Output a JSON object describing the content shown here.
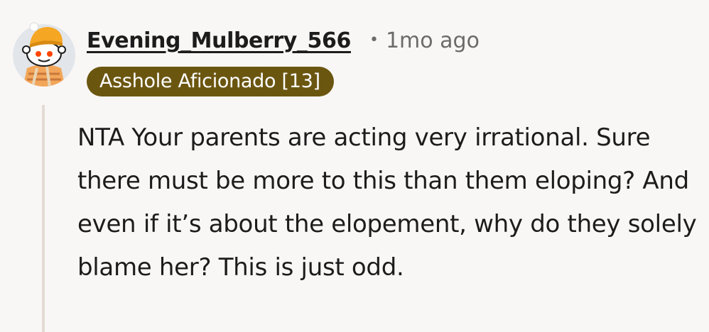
{
  "comment": {
    "author": "Evening_Mulberry_566",
    "separator": "•",
    "timestamp": "1mo ago",
    "flair": "Asshole Aficionado [13]",
    "body": "NTA Your parents are acting very irrational. Sure there must be more to this than them eloping? And even if it’s about the elopement, why do they solely blame her? This is just odd."
  },
  "colors": {
    "background": "#f9f7f5",
    "flair_background": "#6b5610",
    "flair_text": "#ffffff",
    "thread_line": "#e3dbd4",
    "meta_text": "#6b6b6b",
    "primary_text": "#1c1c1c"
  },
  "icons": {
    "avatar": "snoo-avatar-icon"
  }
}
